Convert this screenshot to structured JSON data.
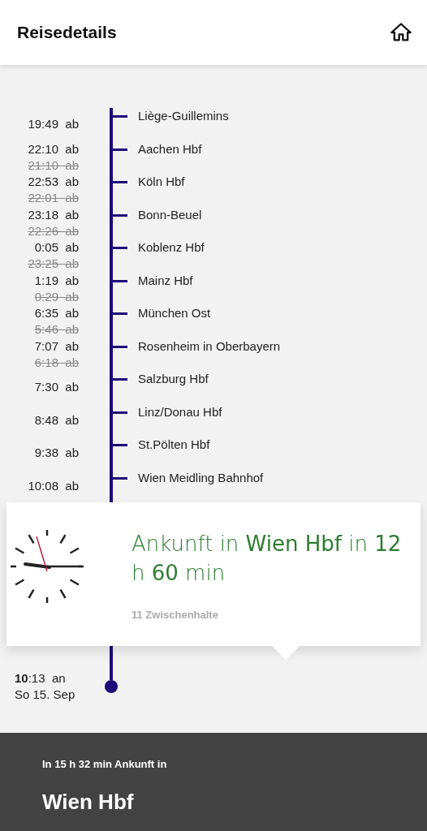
{
  "header": {
    "title": "Reisedetails"
  },
  "stops": [
    {
      "name": "Liège-Guillemins",
      "time": "19:49",
      "suffix": "ab"
    },
    {
      "name": "Aachen Hbf",
      "time": "22:10",
      "suffix": "ab",
      "planned": "21:10",
      "planned_suffix": "ab"
    },
    {
      "name": "Köln Hbf",
      "time": "22:53",
      "suffix": "ab",
      "planned": "22:01",
      "planned_suffix": "ab"
    },
    {
      "name": "Bonn-Beuel",
      "time": "23:18",
      "suffix": "ab",
      "planned": "22:26",
      "planned_suffix": "ab"
    },
    {
      "name": "Koblenz Hbf",
      "time": "0:05",
      "suffix": "ab",
      "planned": "23:25",
      "planned_suffix": "ab"
    },
    {
      "name": "Mainz Hbf",
      "time": "1:19",
      "suffix": "ab",
      "planned": "0:29",
      "planned_suffix": "ab"
    },
    {
      "name": "München Ost",
      "time": "6:35",
      "suffix": "ab",
      "planned": "5:46",
      "planned_suffix": "ab"
    },
    {
      "name": "Rosenheim in Oberbayern",
      "time": "7:07",
      "suffix": "ab",
      "planned": "6:18",
      "planned_suffix": "ab"
    },
    {
      "name": "Salzburg Hbf",
      "time": "7:30",
      "suffix": "ab"
    },
    {
      "name": "Linz/Donau Hbf",
      "time": "8:48",
      "suffix": "ab"
    },
    {
      "name": "St.Pölten Hbf",
      "time": "9:38",
      "suffix": "ab"
    },
    {
      "name": "Wien Meidling Bahnhof",
      "time": "10:08",
      "suffix": "ab"
    }
  ],
  "arrival_card": {
    "headline": "Ankunft in **Wien Hbf** in **12** h **60** min",
    "note": "11 Zwischenhalte"
  },
  "arrival": {
    "time": "**10**:13",
    "suffix": "an",
    "date": "So 15. Sep"
  },
  "footer": {
    "subtitle": "In 15 h 32 min Ankunft in",
    "destination": "Wien Hbf"
  }
}
